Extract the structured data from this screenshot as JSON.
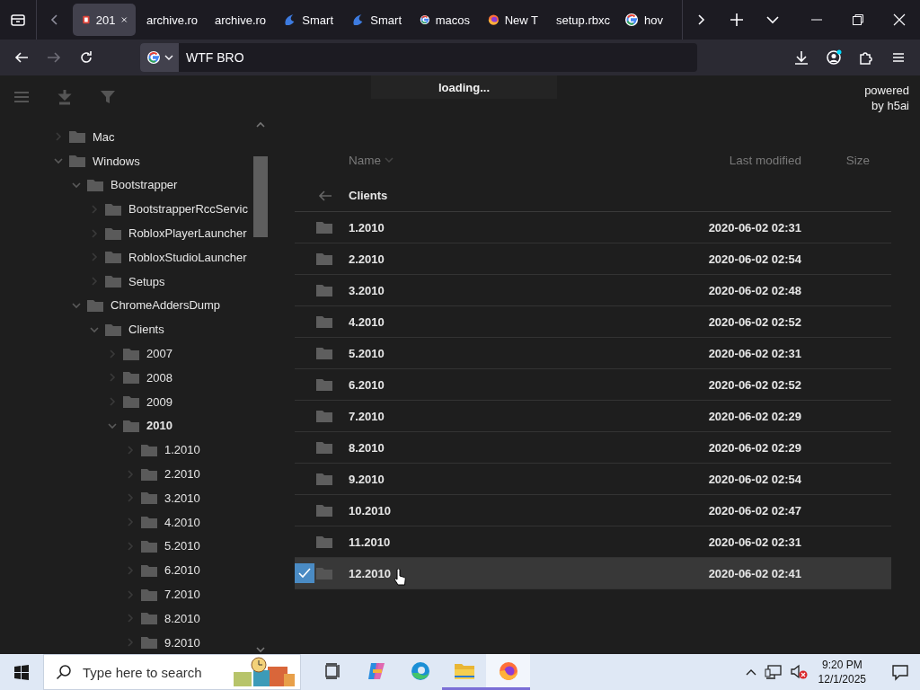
{
  "browser": {
    "tabs": [
      {
        "title": "201",
        "kind": "document",
        "selected": true
      },
      {
        "title": "archive.ro",
        "kind": "plain",
        "selected": false
      },
      {
        "title": "archive.ro",
        "kind": "plain",
        "selected": false
      },
      {
        "title": "Smart",
        "kind": "swirl",
        "selected": false
      },
      {
        "title": "Smart",
        "kind": "swirl",
        "selected": false
      },
      {
        "title": "macos",
        "kind": "google",
        "selected": false
      },
      {
        "title": "New T",
        "kind": "firefox",
        "selected": false
      },
      {
        "title": "setup.rbxc",
        "kind": "plain",
        "selected": false
      },
      {
        "title": "hov",
        "kind": "google",
        "selected": false
      }
    ],
    "address_bar": {
      "value": "WTF BRO"
    }
  },
  "page": {
    "notice": "loading...",
    "credit": "powered by h5ai",
    "sidebar": {
      "tree": [
        {
          "label": "Mac",
          "expanded": false,
          "selected": false
        },
        {
          "label": "Windows",
          "expanded": true,
          "selected": false,
          "children": [
            {
              "label": "Bootstrapper",
              "expanded": true,
              "selected": false,
              "children": [
                {
                  "label": "BootstrapperRccServic",
                  "expanded": false,
                  "selected": false
                },
                {
                  "label": "RobloxPlayerLauncher",
                  "expanded": false,
                  "selected": false
                },
                {
                  "label": "RobloxStudioLauncher",
                  "expanded": false,
                  "selected": false
                },
                {
                  "label": "Setups",
                  "expanded": false,
                  "selected": false
                }
              ]
            },
            {
              "label": "ChromeAddersDump",
              "expanded": true,
              "selected": false,
              "children": [
                {
                  "label": "Clients",
                  "expanded": true,
                  "selected": false,
                  "children": [
                    {
                      "label": "2007",
                      "expanded": false,
                      "selected": false
                    },
                    {
                      "label": "2008",
                      "expanded": false,
                      "selected": false
                    },
                    {
                      "label": "2009",
                      "expanded": false,
                      "selected": false
                    },
                    {
                      "label": "2010",
                      "expanded": true,
                      "selected": true,
                      "children": [
                        {
                          "label": "1.2010",
                          "expanded": false,
                          "selected": false
                        },
                        {
                          "label": "2.2010",
                          "expanded": false,
                          "selected": false
                        },
                        {
                          "label": "3.2010",
                          "expanded": false,
                          "selected": false
                        },
                        {
                          "label": "4.2010",
                          "expanded": false,
                          "selected": false
                        },
                        {
                          "label": "5.2010",
                          "expanded": false,
                          "selected": false
                        },
                        {
                          "label": "6.2010",
                          "expanded": false,
                          "selected": false
                        },
                        {
                          "label": "7.2010",
                          "expanded": false,
                          "selected": false
                        },
                        {
                          "label": "8.2010",
                          "expanded": false,
                          "selected": false
                        },
                        {
                          "label": "9.2010",
                          "expanded": false,
                          "selected": false
                        }
                      ]
                    }
                  ]
                }
              ]
            }
          ]
        }
      ]
    },
    "listing": {
      "columns": [
        "Name",
        "Last modified",
        "Size"
      ],
      "parent": "Clients",
      "rows": [
        {
          "name": "1.2010",
          "modified": "2020-06-02 02:31",
          "selected": false
        },
        {
          "name": "2.2010",
          "modified": "2020-06-02 02:54",
          "selected": false
        },
        {
          "name": "3.2010",
          "modified": "2020-06-02 02:48",
          "selected": false
        },
        {
          "name": "4.2010",
          "modified": "2020-06-02 02:52",
          "selected": false
        },
        {
          "name": "5.2010",
          "modified": "2020-06-02 02:31",
          "selected": false
        },
        {
          "name": "6.2010",
          "modified": "2020-06-02 02:52",
          "selected": false
        },
        {
          "name": "7.2010",
          "modified": "2020-06-02 02:29",
          "selected": false
        },
        {
          "name": "8.2010",
          "modified": "2020-06-02 02:29",
          "selected": false
        },
        {
          "name": "9.2010",
          "modified": "2020-06-02 02:54",
          "selected": false
        },
        {
          "name": "10.2010",
          "modified": "2020-06-02 02:47",
          "selected": false
        },
        {
          "name": "11.2010",
          "modified": "2020-06-02 02:31",
          "selected": false
        },
        {
          "name": "12.2010",
          "modified": "2020-06-02 02:41",
          "selected": true
        }
      ]
    }
  },
  "taskbar": {
    "search": {
      "placeholder": "Type here to search"
    },
    "apps": [
      {
        "kind": "task-view",
        "open": false,
        "selected": false
      },
      {
        "kind": "copilot",
        "open": false,
        "selected": false
      },
      {
        "kind": "edge",
        "open": false,
        "selected": false
      },
      {
        "kind": "explorer",
        "open": true,
        "selected": false
      },
      {
        "kind": "firefox",
        "open": true,
        "selected": true
      }
    ],
    "clock": {
      "time": "9:20 PM",
      "date": "12/1/2025"
    }
  }
}
